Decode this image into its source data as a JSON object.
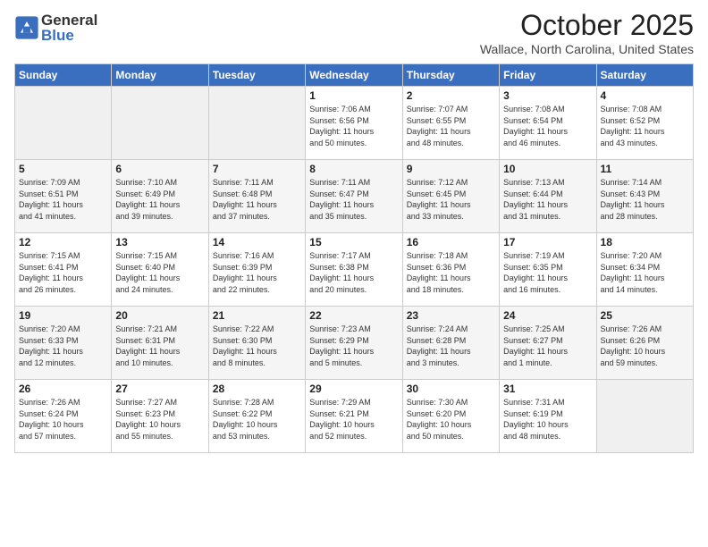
{
  "logo": {
    "general": "General",
    "blue": "Blue"
  },
  "title": "October 2025",
  "location": "Wallace, North Carolina, United States",
  "weekdays": [
    "Sunday",
    "Monday",
    "Tuesday",
    "Wednesday",
    "Thursday",
    "Friday",
    "Saturday"
  ],
  "rows": [
    [
      {
        "day": "",
        "info": ""
      },
      {
        "day": "",
        "info": ""
      },
      {
        "day": "",
        "info": ""
      },
      {
        "day": "1",
        "info": "Sunrise: 7:06 AM\nSunset: 6:56 PM\nDaylight: 11 hours\nand 50 minutes."
      },
      {
        "day": "2",
        "info": "Sunrise: 7:07 AM\nSunset: 6:55 PM\nDaylight: 11 hours\nand 48 minutes."
      },
      {
        "day": "3",
        "info": "Sunrise: 7:08 AM\nSunset: 6:54 PM\nDaylight: 11 hours\nand 46 minutes."
      },
      {
        "day": "4",
        "info": "Sunrise: 7:08 AM\nSunset: 6:52 PM\nDaylight: 11 hours\nand 43 minutes."
      }
    ],
    [
      {
        "day": "5",
        "info": "Sunrise: 7:09 AM\nSunset: 6:51 PM\nDaylight: 11 hours\nand 41 minutes."
      },
      {
        "day": "6",
        "info": "Sunrise: 7:10 AM\nSunset: 6:49 PM\nDaylight: 11 hours\nand 39 minutes."
      },
      {
        "day": "7",
        "info": "Sunrise: 7:11 AM\nSunset: 6:48 PM\nDaylight: 11 hours\nand 37 minutes."
      },
      {
        "day": "8",
        "info": "Sunrise: 7:11 AM\nSunset: 6:47 PM\nDaylight: 11 hours\nand 35 minutes."
      },
      {
        "day": "9",
        "info": "Sunrise: 7:12 AM\nSunset: 6:45 PM\nDaylight: 11 hours\nand 33 minutes."
      },
      {
        "day": "10",
        "info": "Sunrise: 7:13 AM\nSunset: 6:44 PM\nDaylight: 11 hours\nand 31 minutes."
      },
      {
        "day": "11",
        "info": "Sunrise: 7:14 AM\nSunset: 6:43 PM\nDaylight: 11 hours\nand 28 minutes."
      }
    ],
    [
      {
        "day": "12",
        "info": "Sunrise: 7:15 AM\nSunset: 6:41 PM\nDaylight: 11 hours\nand 26 minutes."
      },
      {
        "day": "13",
        "info": "Sunrise: 7:15 AM\nSunset: 6:40 PM\nDaylight: 11 hours\nand 24 minutes."
      },
      {
        "day": "14",
        "info": "Sunrise: 7:16 AM\nSunset: 6:39 PM\nDaylight: 11 hours\nand 22 minutes."
      },
      {
        "day": "15",
        "info": "Sunrise: 7:17 AM\nSunset: 6:38 PM\nDaylight: 11 hours\nand 20 minutes."
      },
      {
        "day": "16",
        "info": "Sunrise: 7:18 AM\nSunset: 6:36 PM\nDaylight: 11 hours\nand 18 minutes."
      },
      {
        "day": "17",
        "info": "Sunrise: 7:19 AM\nSunset: 6:35 PM\nDaylight: 11 hours\nand 16 minutes."
      },
      {
        "day": "18",
        "info": "Sunrise: 7:20 AM\nSunset: 6:34 PM\nDaylight: 11 hours\nand 14 minutes."
      }
    ],
    [
      {
        "day": "19",
        "info": "Sunrise: 7:20 AM\nSunset: 6:33 PM\nDaylight: 11 hours\nand 12 minutes."
      },
      {
        "day": "20",
        "info": "Sunrise: 7:21 AM\nSunset: 6:31 PM\nDaylight: 11 hours\nand 10 minutes."
      },
      {
        "day": "21",
        "info": "Sunrise: 7:22 AM\nSunset: 6:30 PM\nDaylight: 11 hours\nand 8 minutes."
      },
      {
        "day": "22",
        "info": "Sunrise: 7:23 AM\nSunset: 6:29 PM\nDaylight: 11 hours\nand 5 minutes."
      },
      {
        "day": "23",
        "info": "Sunrise: 7:24 AM\nSunset: 6:28 PM\nDaylight: 11 hours\nand 3 minutes."
      },
      {
        "day": "24",
        "info": "Sunrise: 7:25 AM\nSunset: 6:27 PM\nDaylight: 11 hours\nand 1 minute."
      },
      {
        "day": "25",
        "info": "Sunrise: 7:26 AM\nSunset: 6:26 PM\nDaylight: 10 hours\nand 59 minutes."
      }
    ],
    [
      {
        "day": "26",
        "info": "Sunrise: 7:26 AM\nSunset: 6:24 PM\nDaylight: 10 hours\nand 57 minutes."
      },
      {
        "day": "27",
        "info": "Sunrise: 7:27 AM\nSunset: 6:23 PM\nDaylight: 10 hours\nand 55 minutes."
      },
      {
        "day": "28",
        "info": "Sunrise: 7:28 AM\nSunset: 6:22 PM\nDaylight: 10 hours\nand 53 minutes."
      },
      {
        "day": "29",
        "info": "Sunrise: 7:29 AM\nSunset: 6:21 PM\nDaylight: 10 hours\nand 52 minutes."
      },
      {
        "day": "30",
        "info": "Sunrise: 7:30 AM\nSunset: 6:20 PM\nDaylight: 10 hours\nand 50 minutes."
      },
      {
        "day": "31",
        "info": "Sunrise: 7:31 AM\nSunset: 6:19 PM\nDaylight: 10 hours\nand 48 minutes."
      },
      {
        "day": "",
        "info": ""
      }
    ]
  ]
}
